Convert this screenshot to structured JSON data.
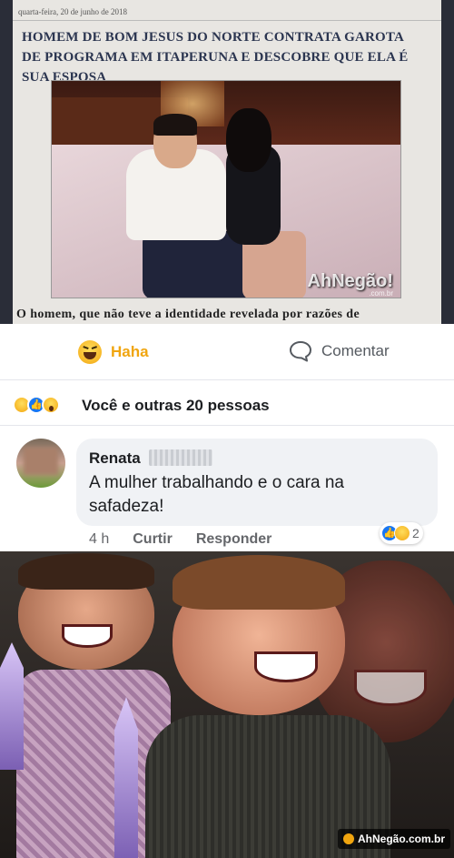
{
  "clipping": {
    "date": "quarta-feira, 20 de junho de 2018",
    "headline": "HOMEM DE BOM JESUS DO NORTE CONTRATA GAROTA DE PROGRAMA EM ITAPERUNA E DESCOBRE QUE ELA É SUA ESPOSA",
    "photo_watermark": "AhNegão!",
    "photo_watermark_sub": ".com.br",
    "caption": "O homem, que não teve a identidade revelada por razões de"
  },
  "actions": {
    "reaction_label": "Haha",
    "reaction_icon": "haha-emoji-icon",
    "comment_label": "Comentar",
    "comment_icon": "comment-bubble-icon",
    "reaction_color": "#f0a50f"
  },
  "reaction_summary": {
    "icons": [
      "haha-icon",
      "like-icon",
      "wow-icon"
    ],
    "text": "Você e outras 20 pessoas"
  },
  "comment": {
    "author": "Renata",
    "text": "A mulher trabalhando e o cara na safadeza!",
    "time": "4 h",
    "like_label": "Curtir",
    "reply_label": "Responder",
    "reaction_count": "2"
  },
  "meme": {
    "watermark": "AhNegão.com.br"
  },
  "colors": {
    "facebook_blue": "#1877f2",
    "bubble_bg": "#f0f2f5",
    "meta_text": "#65676b"
  }
}
